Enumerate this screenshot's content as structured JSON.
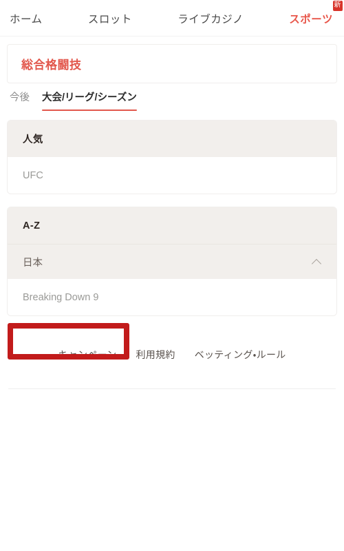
{
  "nav": {
    "items": [
      {
        "label": "ホーム",
        "active": false
      },
      {
        "label": "スロット",
        "active": false
      },
      {
        "label": "ライブカジノ",
        "active": false
      },
      {
        "label": "スポーツ",
        "active": true,
        "badge": "新"
      }
    ],
    "badge_label": "新"
  },
  "page": {
    "title": "総合格闘技"
  },
  "tabs": [
    {
      "label": "今後",
      "active": false
    },
    {
      "label": "大会/リーグ/シーズン",
      "active": true
    }
  ],
  "sections": {
    "popular": {
      "heading": "人気",
      "items": [
        {
          "label": "UFC"
        }
      ]
    },
    "az": {
      "heading": "A-Z",
      "groups": [
        {
          "label": "日本",
          "expanded": true,
          "chevron": "chevron-up-icon",
          "items": [
            {
              "label": "Breaking Down 9",
              "highlighted": true
            }
          ]
        }
      ]
    }
  },
  "footer": {
    "links": [
      {
        "label": "キャンペーン"
      },
      {
        "label": "利用規約"
      },
      {
        "label": "ベッティング・ルール"
      }
    ]
  },
  "colors": {
    "accent_red": "#e2574c",
    "badge_red": "#d8342a",
    "annotation_red": "#c21b1b",
    "section_beige": "#f2efec",
    "muted_text": "#9a9a97"
  }
}
